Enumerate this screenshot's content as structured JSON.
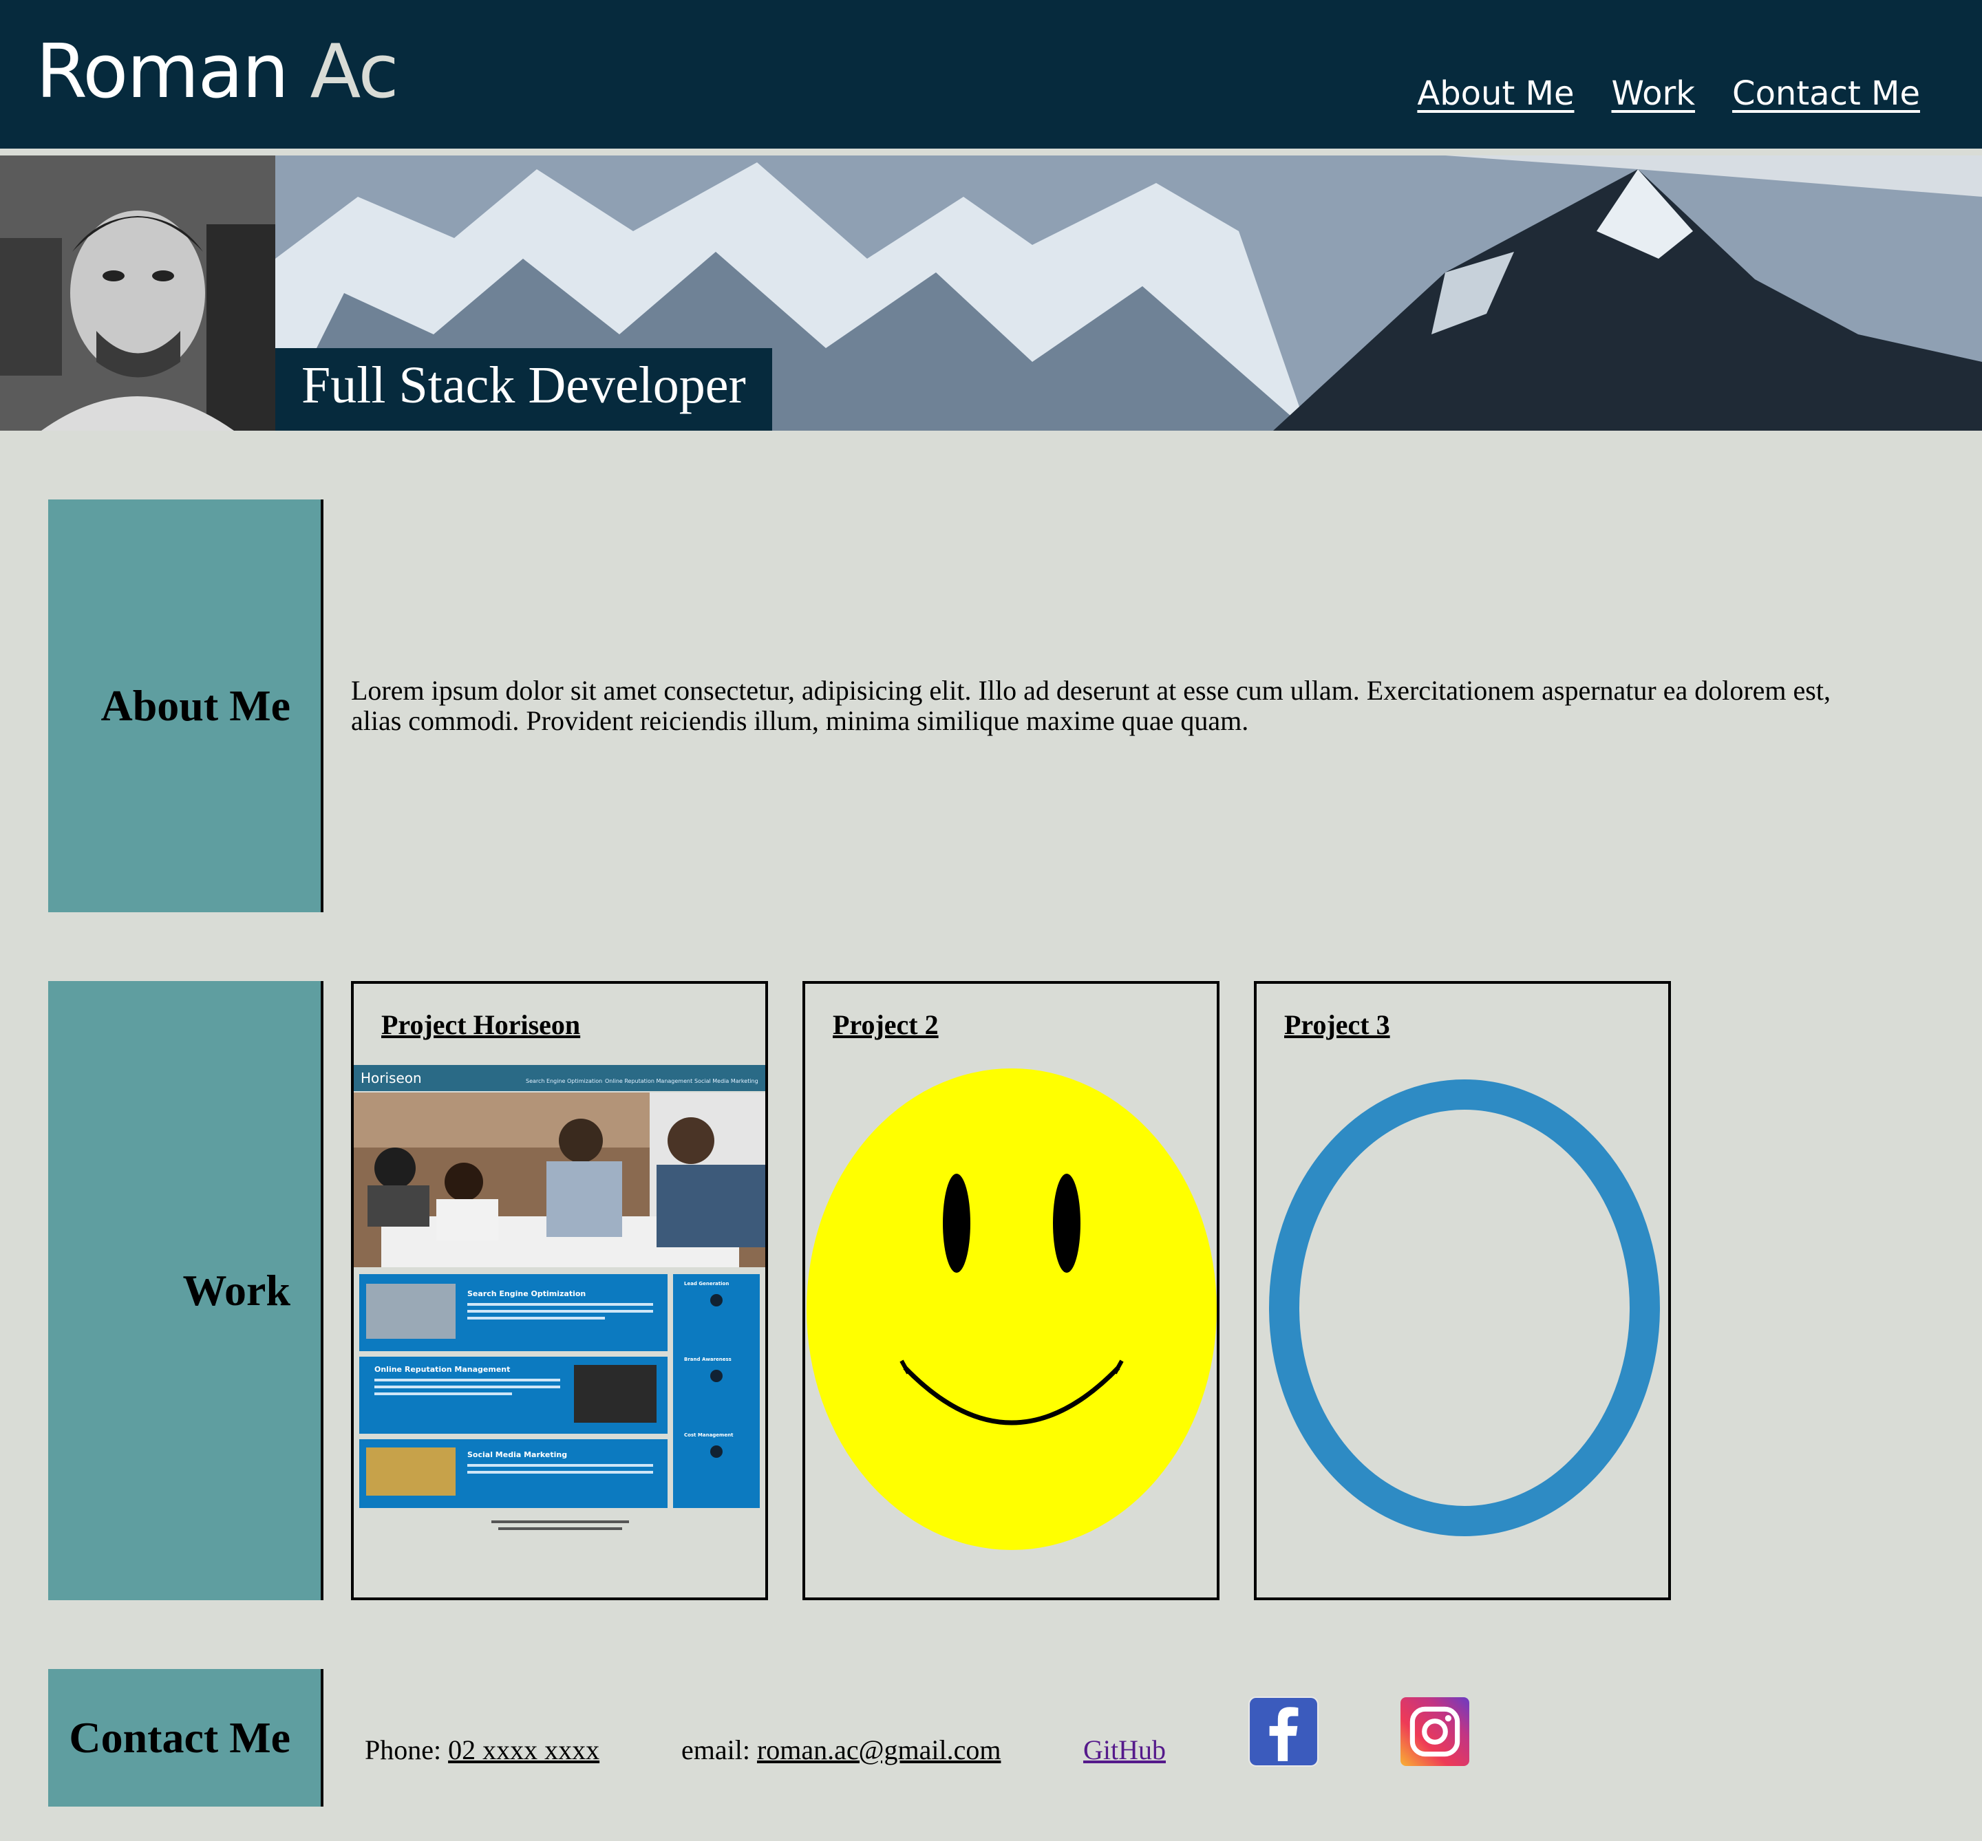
{
  "header": {
    "brand_first": "Roman",
    "brand_last": "Ac",
    "nav": [
      {
        "label": "About Me"
      },
      {
        "label": "Work"
      },
      {
        "label": "Contact Me"
      }
    ]
  },
  "hero": {
    "title": "Full Stack Developer"
  },
  "about": {
    "heading": "About Me",
    "text": "Lorem ipsum dolor sit amet consectetur, adipisicing elit. Illo ad deserunt at esse cum ullam. Exercitationem aspernatur ea dolorem est, alias commodi. Provident reiciendis illum, minima similique maxime quae quam."
  },
  "work": {
    "heading": "Work",
    "projects": [
      {
        "title": "Project Horiseon",
        "image": "horiseon-screenshot"
      },
      {
        "title": "Project 2",
        "image": "smiley-face"
      },
      {
        "title": "Project 3",
        "image": "blue-ring"
      }
    ],
    "horiseon_preview": {
      "logo": "Horiseon",
      "nav": [
        "Search Engine Optimization",
        "Online Reputation Management",
        "Social Media Marketing"
      ],
      "sections": [
        "Search Engine Optimization",
        "Online Reputation Management",
        "Social Media Marketing"
      ],
      "side": [
        "Lead Generation",
        "Brand Awareness",
        "Cost Management"
      ]
    }
  },
  "contact": {
    "heading": "Contact Me",
    "phone_label": "Phone:",
    "phone": "02 xxxx xxxx",
    "email_label": "email:",
    "email": "roman.ac@gmail.com",
    "github": "GitHub",
    "icons": [
      "facebook-icon",
      "instagram-icon"
    ]
  },
  "colors": {
    "header_bg": "#062a3d",
    "page_bg": "#d9dcd6",
    "side_bg": "#5f9ea0",
    "smiley": "#ffff00",
    "ring": "#2e8bc4"
  }
}
